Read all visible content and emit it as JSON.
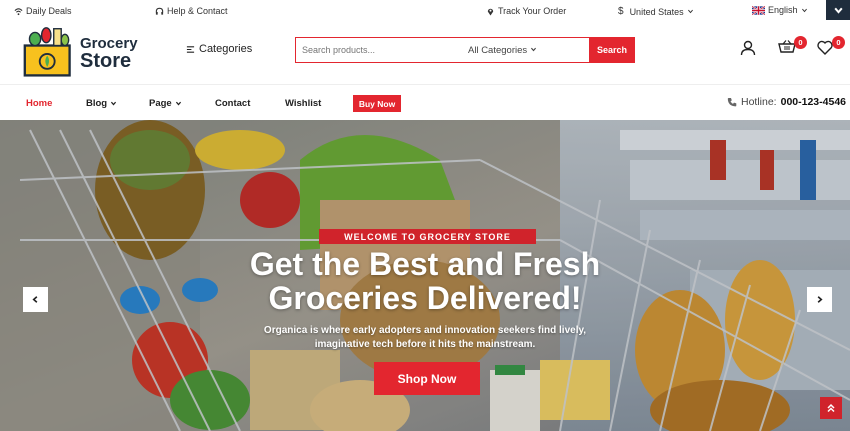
{
  "topbar": {
    "daily_deals": "Daily Deals",
    "help": "Help & Contact",
    "track": "Track Your Order",
    "country": "United States",
    "language": "English"
  },
  "header": {
    "logo_line1": "Grocery",
    "logo_line2": "Store",
    "categories_label": "Categories",
    "search_placeholder": "Search products...",
    "search_category": "All Categories",
    "search_button": "Search",
    "cart_count": "0",
    "wishlist_count": "0"
  },
  "nav": {
    "items": [
      {
        "label": "Home",
        "active": true
      },
      {
        "label": "Blog",
        "dropdown": true
      },
      {
        "label": "Page",
        "dropdown": true
      },
      {
        "label": "Contact"
      },
      {
        "label": "Wishlist"
      }
    ],
    "buy_now": "Buy Now",
    "hotline_label": "Hotline:",
    "hotline_number": "000-123-4546"
  },
  "hero": {
    "kicker": "WELCOME TO GROCERY STORE",
    "headline_1": "Get the Best and Fresh",
    "headline_2": "Groceries Delivered!",
    "sub_1": "Organica is where early adopters and innovation seekers find lively,",
    "sub_2": "imaginative tech before it hits the mainstream.",
    "cta": "Shop Now"
  },
  "colors": {
    "accent": "#e3262f",
    "dark": "#1f2d3d"
  },
  "icons": [
    "wifi-icon",
    "headset-icon",
    "location-pin-icon",
    "dollar-icon",
    "uk-flag-icon",
    "chevron-down-icon",
    "hamburger-icon",
    "user-icon",
    "cart-icon",
    "heart-icon",
    "phone-icon",
    "chevron-left-icon",
    "chevron-right-icon",
    "double-chevron-up-icon"
  ]
}
